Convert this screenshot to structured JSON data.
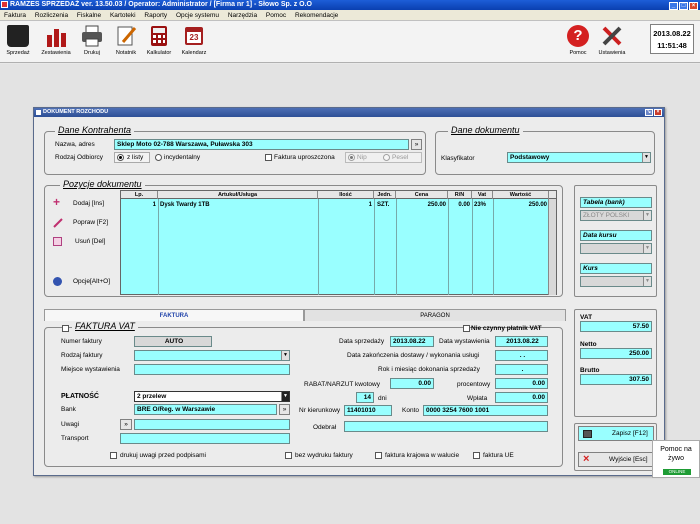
{
  "app": {
    "title": "RAMZES SPRZEDAŻ ver. 13.50.03 /  Operator: Administrator /   [Firma nr 1] - Słowo Sp. z O.O",
    "menu": [
      "Faktura",
      "Rozliczenia",
      "Fiskalne",
      "Kartoteki",
      "Raporty",
      "Opcje systemu",
      "Narzędzia",
      "Pomoc",
      "Rekomendacje"
    ]
  },
  "toolbar": {
    "left": [
      {
        "label": "Sprzedaż",
        "icon": "shopping-bag-icon",
        "color": "#222222"
      },
      {
        "label": "Zestawienia",
        "icon": "bar-chart-icon",
        "color": "#b01818"
      },
      {
        "label": "Drukuj",
        "icon": "printer-icon",
        "color": "#444444"
      },
      {
        "label": "Notatnik",
        "icon": "notepad-icon",
        "color": "#cc6600"
      },
      {
        "label": "Kalkulator",
        "icon": "calculator-icon",
        "color": "#9a1010"
      },
      {
        "label": "Kalendarz",
        "icon": "calendar-icon",
        "color": "#a51f1f"
      }
    ],
    "right": [
      {
        "label": "Pomoc",
        "icon": "help-icon",
        "color": "#d42020"
      },
      {
        "label": "Ustawienia",
        "icon": "tools-icon",
        "color": "#cc2020"
      }
    ],
    "calendar_day": "23",
    "date": "2013.08.22",
    "time": "11:51:48"
  },
  "dialog": {
    "title": "DOKUMENT ROZCHODU",
    "kontrahent": {
      "title": "Dane Kontrahenta",
      "name_label": "Nazwa, adres",
      "name_value": "Sklep Moto 02-788 Warszawa, Puławska 303",
      "name_btn": "»",
      "odbiorca_label": "Rodzaj Odbiorcy",
      "radio_zlisty": "z listy",
      "radio_incydentalny": "incydentalny",
      "faktura_uproszczona": "Faktura uproszczona",
      "nip": "Nip",
      "pesel": "Pesel"
    },
    "dokument": {
      "title": "Dane dokumentu",
      "klasyfikator_label": "Klasyfikator",
      "klasyfikator_value": "Podstawowy"
    },
    "pozycje": {
      "title": "Pozycje dokumentu",
      "buttons": [
        "Dodaj   [Ins]",
        "Popraw   [F2]",
        "Usuń   [Del]",
        "Opcje[Alt+O]"
      ],
      "columns": [
        "Lp.",
        "Artukuł/Usługa",
        "Ilość",
        "Jedn.",
        "Cena",
        "R/N",
        "Vat",
        "Wartość"
      ],
      "rows": [
        {
          "lp": "1",
          "artykul": "Dysk Twardy 1TB",
          "ilosc": "1",
          "jedn": "SZT.",
          "cena": "250.00",
          "rn": "0.00",
          "vat": "23%",
          "wartosc": "250.00"
        }
      ]
    },
    "side": {
      "tabela_label": "Tabela (bank)",
      "tabela_value": "ZŁOTY POLSKI",
      "data_kursu_label": "Data kursu",
      "kurs_label": "Kurs"
    },
    "tabs": [
      "FAKTURA",
      "PARAGON"
    ],
    "faktura": {
      "title": "FAKTURA VAT",
      "numer_label": "Numer faktury",
      "numer_value": "AUTO",
      "rodzaj_label": "Rodzaj faktury",
      "miejsce_label": "Miejsce wystawienia",
      "platnosc_label": "PŁATNOŚĆ",
      "platnosc_value": "2 przelew",
      "bank_label": "Bank",
      "bank_value": "BRE O/Reg. w Warszawie",
      "uwagi_label": "Uwagi",
      "transport_label": "Transport",
      "nie_czynny": "Nie czynny płatnik VAT",
      "data_sprzedazy_label": "Data sprzedaży",
      "data_sprzedazy": "2013.08.22",
      "data_wystawienia_label": "Data wystawienia",
      "data_wystawienia": "2013.08.22",
      "data_zak_label": "Data zakończenia dostawy / wykonania usługi",
      "data_zak_value": ". .",
      "rok_label": "Rok i miesiąc dokonania sprzedaży",
      "rok_value": ".",
      "rabat_label": "RABAT/NARZUT  kwotowy",
      "rabat_value": "0.00",
      "procentowy_label": "procentowy",
      "procentowy_value": "0.00",
      "dni_value": "14",
      "dni_label": "dni",
      "wplata_label": "Wpłata",
      "wplata_value": "0.00",
      "nr_kier_label": "Nr kierunkowy",
      "nr_kier_value": "11401010",
      "konto_label": "Konto",
      "konto_value": "0000 3254 7600 1001",
      "odebral_label": "Odebrał",
      "drukuj_uwagi": "drukuj uwagi przed podpisami",
      "bez_wydruku": "bez wydruku faktury",
      "krajowa": "faktura krajowa w walucie",
      "faktura_ue": "faktura UE"
    },
    "totals": {
      "vat_label": "VAT",
      "vat_value": "57.50",
      "netto_label": "Netto",
      "netto_value": "250.00",
      "brutto_label": "Brutto",
      "brutto_value": "307.50"
    },
    "zapisz": "Zapisz  [F12]",
    "wyjscie": "Wyjście  [Esc]"
  },
  "pomoc_widget": {
    "line1": "Pomoc na",
    "line2": "żywo",
    "status": "ONLINE"
  }
}
